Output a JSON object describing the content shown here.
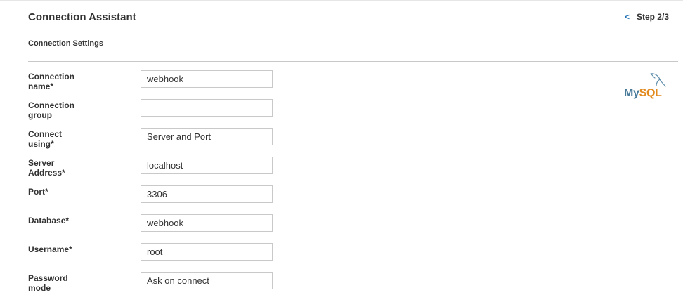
{
  "header": {
    "title": "Connection Assistant",
    "back_symbol": "<",
    "step": "Step 2/3"
  },
  "section": {
    "subtitle": "Connection Settings"
  },
  "form": {
    "fields": [
      {
        "label": "Connection name*",
        "value": "webhook"
      },
      {
        "label": "Connection group",
        "value": ""
      },
      {
        "label": "Connect using*",
        "value": "Server and Port"
      },
      {
        "label": "Server Address*",
        "value": "localhost"
      },
      {
        "label": "Port*",
        "value": "3306"
      },
      {
        "label": "Database*",
        "value": "webhook"
      },
      {
        "label": "Username*",
        "value": "root"
      },
      {
        "label": "Password mode",
        "value": "Ask on connect"
      }
    ]
  },
  "logo": {
    "name": "mysql-logo",
    "text_my": "My",
    "text_sql": "SQL",
    "colors": {
      "my": "#4a7a9a",
      "sql": "#e28a1d"
    }
  }
}
